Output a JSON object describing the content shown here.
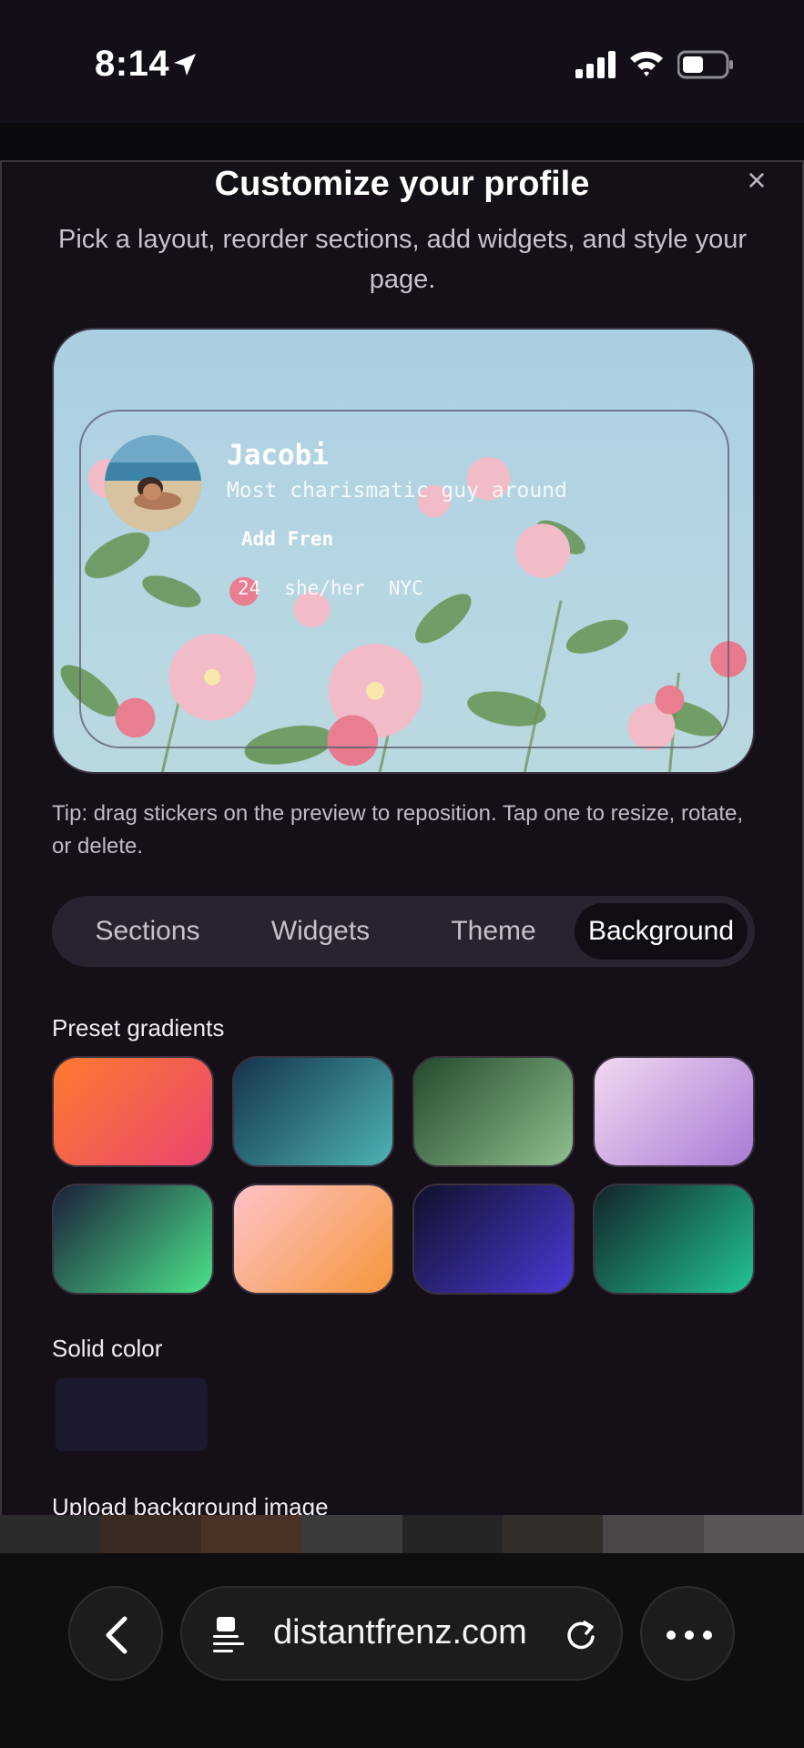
{
  "status_bar": {
    "time": "8:14"
  },
  "modal": {
    "close_label": "×",
    "title": "Customize your profile",
    "subtitle": "Pick a layout, reorder sections, add widgets, and style your page."
  },
  "preview": {
    "name": "Jacobi",
    "bio": "Most charismatic guy around",
    "add_button": "Add Fren",
    "age": "24",
    "pronouns": "she/her",
    "location": "NYC"
  },
  "tip": "Tip: drag stickers on the preview to reposition. Tap one to resize, rotate, or delete.",
  "tabs": [
    {
      "label": "Sections",
      "active": false
    },
    {
      "label": "Widgets",
      "active": false
    },
    {
      "label": "Theme",
      "active": false
    },
    {
      "label": "Background",
      "active": true
    }
  ],
  "background": {
    "preset_label": "Preset gradients",
    "presets": [
      {
        "from": "#ff7a2f",
        "to": "#e8456f"
      },
      {
        "from": "#14334d",
        "to": "#4db3b3"
      },
      {
        "from": "#234a2c",
        "to": "#8fbf8f"
      },
      {
        "from": "#f2d9f0",
        "to": "#a77bd6"
      },
      {
        "from": "#1b1f3a",
        "to": "#4be38a"
      },
      {
        "from": "#ffc3c8",
        "to": "#f4963a"
      },
      {
        "from": "#10102a",
        "to": "#4a3ad6"
      },
      {
        "from": "#12242a",
        "to": "#22c496"
      }
    ],
    "solid_label": "Solid color",
    "solid_color": "#1b1a2e",
    "upload_label": "Upload background image"
  },
  "browser": {
    "url": "distantfrenz.com"
  }
}
